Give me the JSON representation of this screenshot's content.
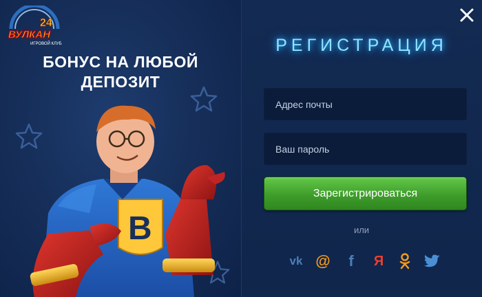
{
  "logo": {
    "number": "24",
    "brand": "ВУЛКАН",
    "tagline": "ИГРОВОЙ КЛУБ"
  },
  "promo": {
    "line1": "БОНУС НА ЛЮБОЙ",
    "line2": "ДЕПОЗИТ"
  },
  "hero_badge": "B",
  "form": {
    "title": "РЕГИСТРАЦИЯ",
    "email_placeholder": "Адрес почты",
    "password_placeholder": "Ваш пароль",
    "submit_label": "Зарегистрироваться",
    "or_label": "или"
  },
  "social": {
    "vk": "vk",
    "mail": "@",
    "facebook": "f",
    "yandex": "Я",
    "odnoklassniki": "ok",
    "twitter": "twitter-icon"
  },
  "colors": {
    "accent_green": "#4bb037",
    "title_glow": "#8ee4ff",
    "social_icon": "#4a7fb8",
    "yandex_red": "#e8402f",
    "mail_orange": "#f39a1c"
  }
}
